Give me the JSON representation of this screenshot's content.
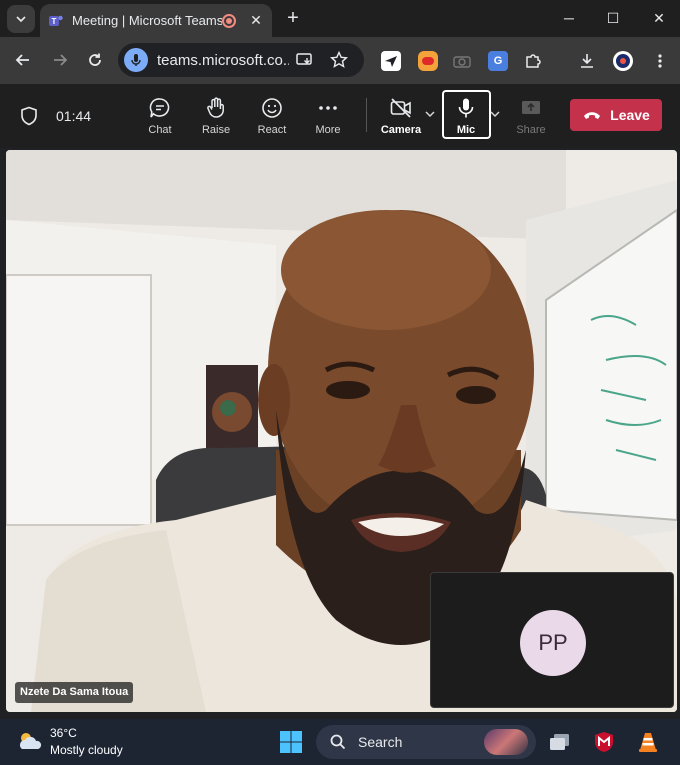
{
  "browser": {
    "tab_title": "Meeting | Microsoft Teams",
    "tab_close": "✕",
    "new_tab": "+",
    "url": "teams.microsoft.co...",
    "window_controls": {
      "minimize": "─",
      "maximize": "☐",
      "close": "✕"
    }
  },
  "meeting": {
    "timer": "01:44",
    "controls": {
      "chat": "Chat",
      "raise": "Raise",
      "react": "React",
      "more": "More",
      "camera": "Camera",
      "mic": "Mic",
      "share": "Share"
    },
    "leave_label": "Leave"
  },
  "participants": {
    "main_name": "Nzete Da Sama Itoua",
    "pip_initials": "PP"
  },
  "taskbar": {
    "temperature": "36°C",
    "condition": "Mostly cloudy",
    "search_label": "Search"
  },
  "colors": {
    "leave": "#c4314b",
    "pip_avatar": "#ead9e8",
    "omnibox_mic": "#7cacf8"
  },
  "icons": [
    "shield-icon",
    "chat-icon",
    "raise-hand-icon",
    "react-icon",
    "more-icon",
    "camera-off-icon",
    "mic-icon",
    "share-icon",
    "phone-hangup-icon",
    "windows-start-icon",
    "search-icon",
    "weather-icon"
  ]
}
